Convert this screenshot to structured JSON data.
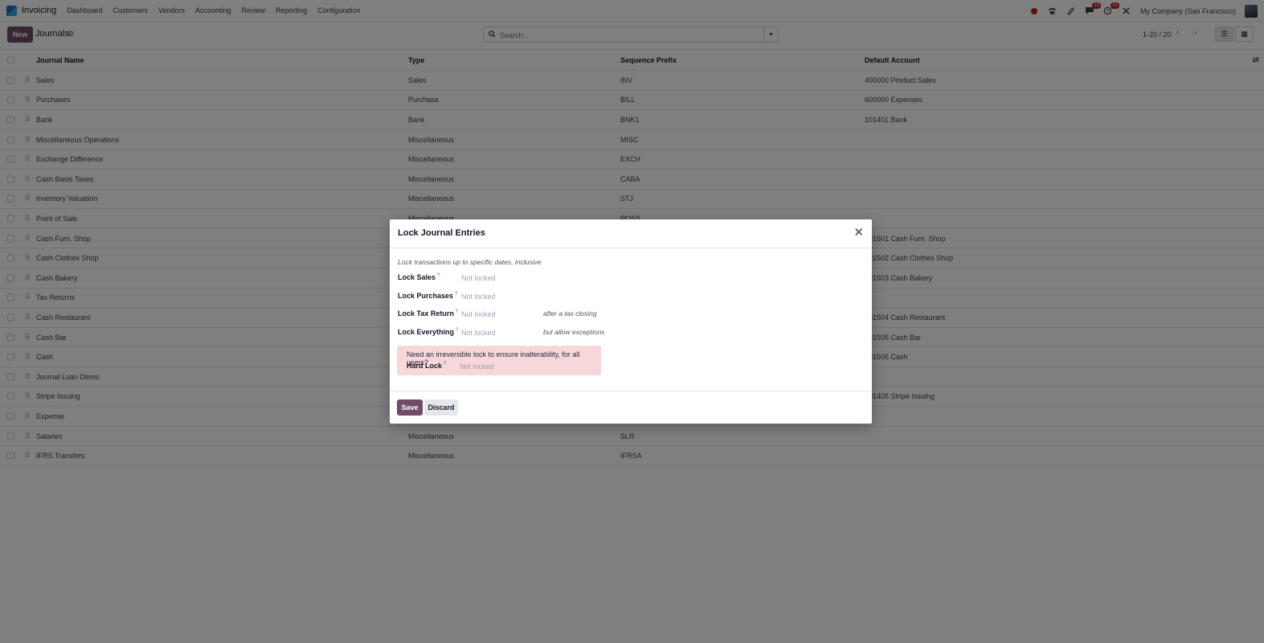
{
  "app": {
    "name": "Invoicing"
  },
  "menu": [
    "Dashboard",
    "Customers",
    "Vendors",
    "Accounting",
    "Review",
    "Reporting",
    "Configuration"
  ],
  "systray": {
    "messages_count": "16",
    "activities_count": "41",
    "company": "My Company (San Francisco)"
  },
  "control": {
    "new_label": "New",
    "title": "Journals",
    "search_placeholder": "Search...",
    "pager": "1-20 / 20"
  },
  "columns": {
    "name": "Journal Name",
    "type": "Type",
    "prefix": "Sequence Prefix",
    "account": "Default Account"
  },
  "rows": [
    {
      "name": "Sales",
      "type": "Sales",
      "prefix": "INV",
      "account": "400000 Product Sales"
    },
    {
      "name": "Purchases",
      "type": "Purchase",
      "prefix": "BILL",
      "account": "600000 Expenses"
    },
    {
      "name": "Bank",
      "type": "Bank",
      "prefix": "BNK1",
      "account": "101401 Bank"
    },
    {
      "name": "Miscellaneous Operations",
      "type": "Miscellaneous",
      "prefix": "MISC",
      "account": ""
    },
    {
      "name": "Exchange Difference",
      "type": "Miscellaneous",
      "prefix": "EXCH",
      "account": ""
    },
    {
      "name": "Cash Basis Taxes",
      "type": "Miscellaneous",
      "prefix": "CABA",
      "account": ""
    },
    {
      "name": "Inventory Valuation",
      "type": "Miscellaneous",
      "prefix": "STJ",
      "account": ""
    },
    {
      "name": "Point of Sale",
      "type": "Miscellaneous",
      "prefix": "POSS",
      "account": ""
    },
    {
      "name": "Cash Furn. Shop",
      "type": "",
      "prefix": "",
      "account": "101501 Cash Furn. Shop"
    },
    {
      "name": "Cash Clothes Shop",
      "type": "",
      "prefix": "",
      "account": "101502 Cash Clothes Shop"
    },
    {
      "name": "Cash Bakery",
      "type": "",
      "prefix": "",
      "account": "101503 Cash Bakery"
    },
    {
      "name": "Tax Returns",
      "type": "",
      "prefix": "",
      "account": ""
    },
    {
      "name": "Cash Restaurant",
      "type": "",
      "prefix": "",
      "account": "101504 Cash Restaurant"
    },
    {
      "name": "Cash Bar",
      "type": "",
      "prefix": "",
      "account": "101505 Cash Bar"
    },
    {
      "name": "Cash",
      "type": "",
      "prefix": "",
      "account": "101506 Cash"
    },
    {
      "name": "Journal Loan Demo",
      "type": "",
      "prefix": "",
      "account": ""
    },
    {
      "name": "Stripe Issuing",
      "type": "",
      "prefix": "",
      "account": "101405 Stripe Issuing"
    },
    {
      "name": "Expense",
      "type": "",
      "prefix": "",
      "account": ""
    },
    {
      "name": "Salaries",
      "type": "Miscellaneous",
      "prefix": "SLR",
      "account": ""
    },
    {
      "name": "IFRS Transfers",
      "type": "Miscellaneous",
      "prefix": "IFRSA",
      "account": ""
    }
  ],
  "dialog": {
    "title": "Lock Journal Entries",
    "description": "Lock transactions up to specific dates, inclusive",
    "fields": [
      {
        "label": "Lock Sales",
        "value": "Not locked",
        "note": ""
      },
      {
        "label": "Lock Purchases",
        "value": "Not locked",
        "note": ""
      },
      {
        "label": "Lock Tax Return",
        "value": "Not locked",
        "note": "after a tax closing"
      },
      {
        "label": "Lock Everything",
        "value": "Not locked",
        "note": "but allow exceptions"
      }
    ],
    "alert": {
      "text": "Need an irreversible lock to ensure inalterability, for all users?",
      "label": "Hard Lock",
      "value": "Not locked"
    },
    "save_label": "Save",
    "discard_label": "Discard"
  },
  "colors": {
    "brand": "#714b67",
    "alert_bg": "#f8d7da",
    "badge": "#b91c1c"
  }
}
